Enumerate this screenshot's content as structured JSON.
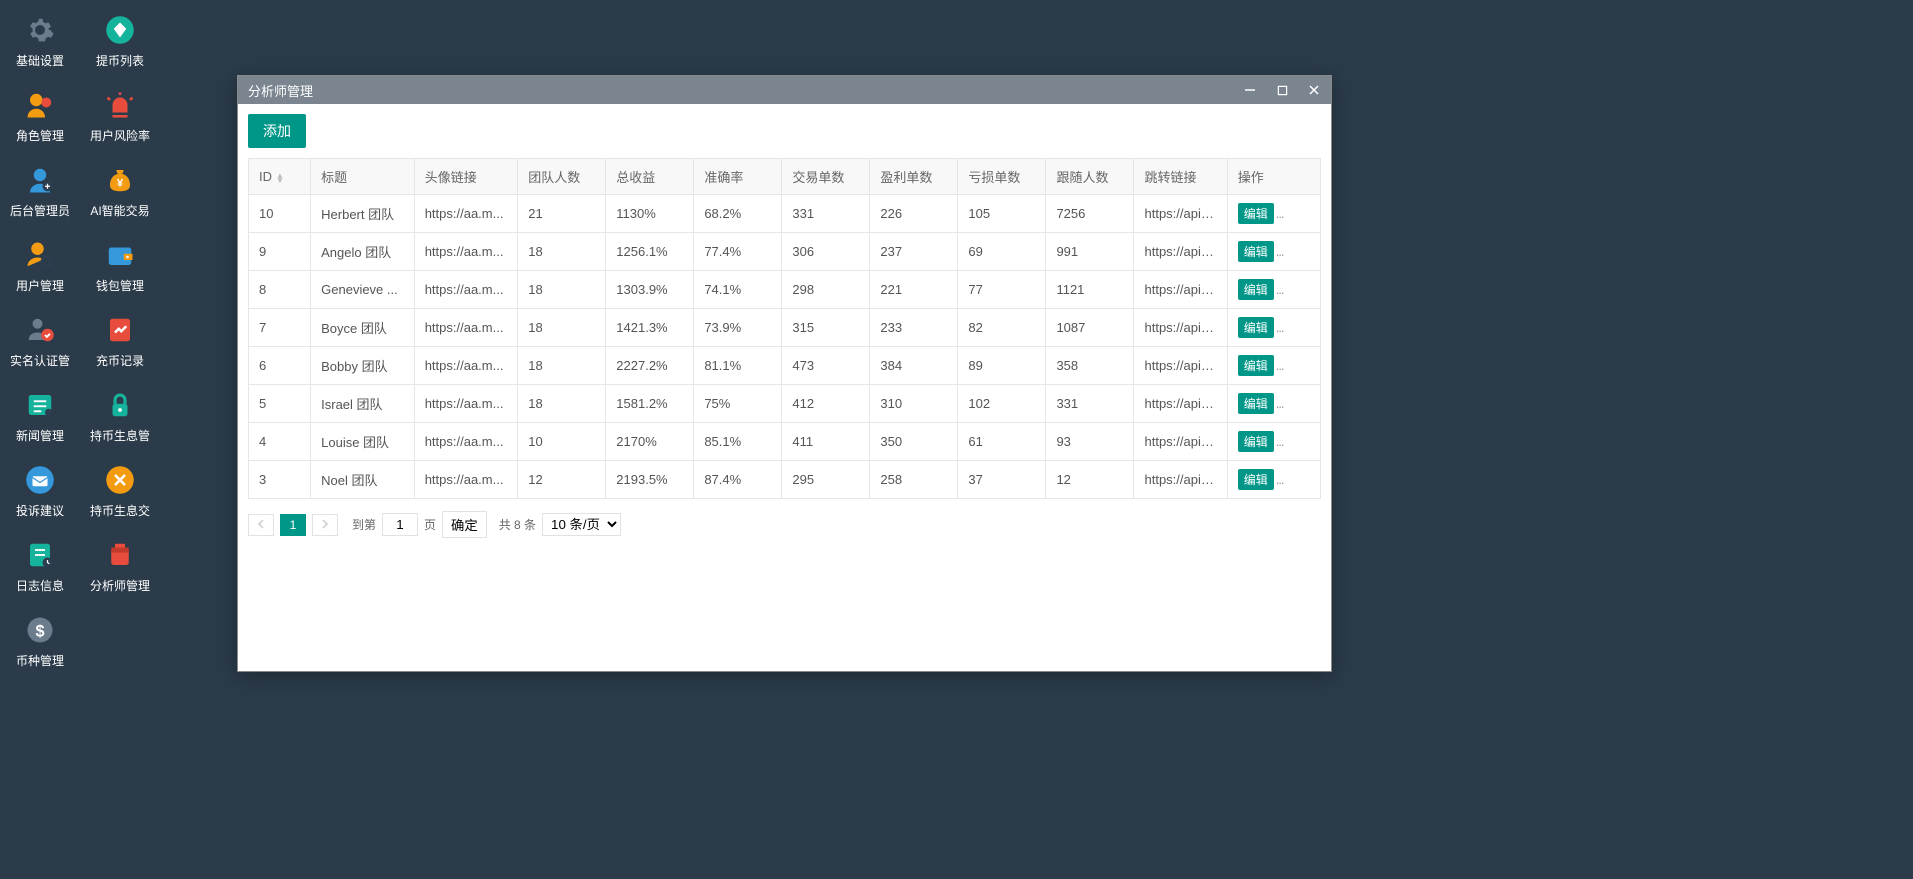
{
  "sidebar": {
    "items": [
      {
        "label": "基础设置",
        "icon": "gear",
        "color": "#6b7c8c"
      },
      {
        "label": "提币列表",
        "icon": "diamond",
        "color": "#16b39c"
      },
      {
        "label": "角色管理",
        "icon": "users",
        "color": "#f39c12"
      },
      {
        "label": "用户风险率",
        "icon": "alarm",
        "color": "#e74c3c"
      },
      {
        "label": "后台管理员",
        "icon": "admin",
        "color": "#3498db"
      },
      {
        "label": "AI智能交易",
        "icon": "money-bag",
        "color": "#f39c12"
      },
      {
        "label": "用户管理",
        "icon": "user-search",
        "color": "#f39c12"
      },
      {
        "label": "钱包管理",
        "icon": "wallet",
        "color": "#3498db"
      },
      {
        "label": "实名认证管",
        "icon": "verify",
        "color": "#6b7c8c"
      },
      {
        "label": "充币记录",
        "icon": "chart",
        "color": "#e74c3c"
      },
      {
        "label": "新闻管理",
        "icon": "news",
        "color": "#16b39c"
      },
      {
        "label": "持币生息管",
        "icon": "lock",
        "color": "#16b39c"
      },
      {
        "label": "投诉建议",
        "icon": "envelope",
        "color": "#3498db"
      },
      {
        "label": "持币生息交",
        "icon": "tools",
        "color": "#f39c12"
      },
      {
        "label": "日志信息",
        "icon": "log",
        "color": "#16b39c"
      },
      {
        "label": "分析师管理",
        "icon": "analyst",
        "color": "#e74c3c"
      },
      {
        "label": "币种管理",
        "icon": "coin",
        "color": "#6b7c8c"
      }
    ]
  },
  "window": {
    "title": "分析师管理",
    "add_label": "添加",
    "columns": [
      "ID",
      "标题",
      "头像链接",
      "团队人数",
      "总收益",
      "准确率",
      "交易单数",
      "盈利单数",
      "亏损单数",
      "跟随人数",
      "跳转链接",
      "操作"
    ],
    "rows": [
      {
        "id": "10",
        "title": "Herbert 团队",
        "avatar": "https://aa.m...",
        "team": "21",
        "profit": "1130%",
        "acc": "68.2%",
        "trade": "331",
        "win": "226",
        "loss": "105",
        "follow": "7256",
        "jump": "https://api.w..."
      },
      {
        "id": "9",
        "title": "Angelo 团队",
        "avatar": "https://aa.m...",
        "team": "18",
        "profit": "1256.1%",
        "acc": "77.4%",
        "trade": "306",
        "win": "237",
        "loss": "69",
        "follow": "991",
        "jump": "https://api.w..."
      },
      {
        "id": "8",
        "title": "Genevieve ...",
        "avatar": "https://aa.m...",
        "team": "18",
        "profit": "1303.9%",
        "acc": "74.1%",
        "trade": "298",
        "win": "221",
        "loss": "77",
        "follow": "1121",
        "jump": "https://api.w..."
      },
      {
        "id": "7",
        "title": "Boyce 团队",
        "avatar": "https://aa.m...",
        "team": "18",
        "profit": "1421.3%",
        "acc": "73.9%",
        "trade": "315",
        "win": "233",
        "loss": "82",
        "follow": "1087",
        "jump": "https://api.w..."
      },
      {
        "id": "6",
        "title": "Bobby 团队",
        "avatar": "https://aa.m...",
        "team": "18",
        "profit": "2227.2%",
        "acc": "81.1%",
        "trade": "473",
        "win": "384",
        "loss": "89",
        "follow": "358",
        "jump": "https://api.w..."
      },
      {
        "id": "5",
        "title": "Israel 团队",
        "avatar": "https://aa.m...",
        "team": "18",
        "profit": "1581.2%",
        "acc": "75%",
        "trade": "412",
        "win": "310",
        "loss": "102",
        "follow": "331",
        "jump": "https://api.w..."
      },
      {
        "id": "4",
        "title": "Louise 团队",
        "avatar": "https://aa.m...",
        "team": "10",
        "profit": "2170%",
        "acc": "85.1%",
        "trade": "411",
        "win": "350",
        "loss": "61",
        "follow": "93",
        "jump": "https://api.w..."
      },
      {
        "id": "3",
        "title": "Noel 团队",
        "avatar": "https://aa.m...",
        "team": "12",
        "profit": "2193.5%",
        "acc": "87.4%",
        "trade": "295",
        "win": "258",
        "loss": "37",
        "follow": "12",
        "jump": "https://api.w..."
      }
    ],
    "edit_label": "编辑",
    "pagination": {
      "current": "1",
      "goto_label": "到第",
      "goto_value": "1",
      "page_suffix": "页",
      "confirm": "确定",
      "total": "共 8 条",
      "per_page": "10 条/页"
    }
  }
}
